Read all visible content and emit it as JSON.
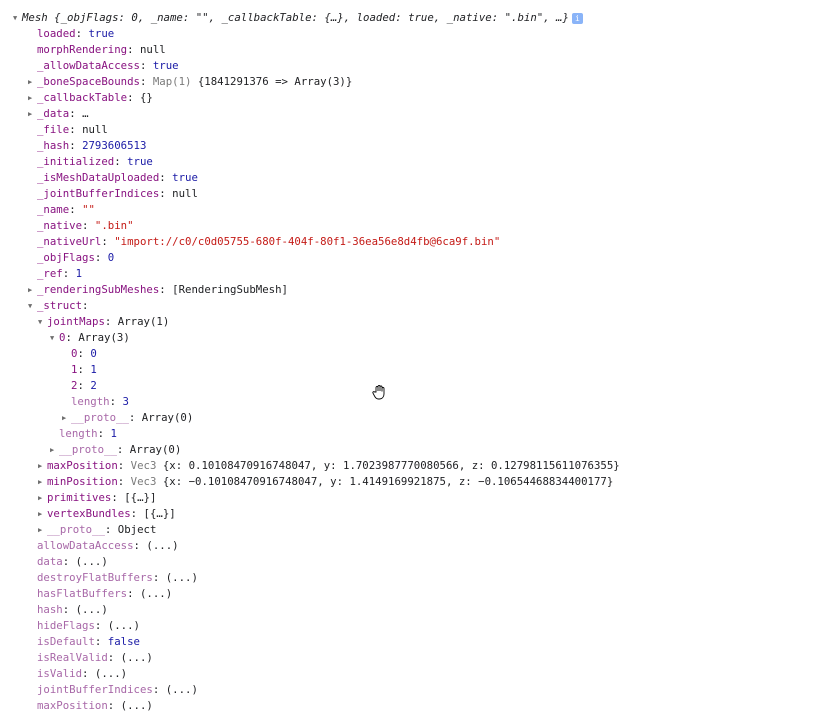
{
  "header": {
    "text": "Mesh {_objFlags: 0, _name: \"\", _callbackTable: {…}, loaded: true, _native: \".bin\", …}",
    "info_icon": "i"
  },
  "rows": [
    {
      "indent": 1,
      "toggle": "none",
      "key": "loaded",
      "kind": "own",
      "sep": ": ",
      "value": "true",
      "vtype": "num"
    },
    {
      "indent": 1,
      "toggle": "none",
      "key": "morphRendering",
      "kind": "own",
      "sep": ": ",
      "value": "null",
      "vtype": "obj"
    },
    {
      "indent": 1,
      "toggle": "none",
      "key": "_allowDataAccess",
      "kind": "own",
      "sep": ": ",
      "value": "true",
      "vtype": "num"
    },
    {
      "indent": 1,
      "toggle": "closed",
      "key": "_boneSpaceBounds",
      "kind": "own",
      "sep": ": ",
      "meta": "Map(1) ",
      "value": "{1841291376 => Array(3)}",
      "vtype": "obj"
    },
    {
      "indent": 1,
      "toggle": "closed",
      "key": "_callbackTable",
      "kind": "own",
      "sep": ": ",
      "value": "{}",
      "vtype": "obj"
    },
    {
      "indent": 1,
      "toggle": "closed",
      "key": "_data",
      "kind": "own",
      "sep": ": ",
      "value": "…",
      "vtype": "obj"
    },
    {
      "indent": 1,
      "toggle": "none",
      "key": "_file",
      "kind": "own",
      "sep": ": ",
      "value": "null",
      "vtype": "obj"
    },
    {
      "indent": 1,
      "toggle": "none",
      "key": "_hash",
      "kind": "own",
      "sep": ": ",
      "value": "2793606513",
      "vtype": "num"
    },
    {
      "indent": 1,
      "toggle": "none",
      "key": "_initialized",
      "kind": "own",
      "sep": ": ",
      "value": "true",
      "vtype": "num"
    },
    {
      "indent": 1,
      "toggle": "none",
      "key": "_isMeshDataUploaded",
      "kind": "own",
      "sep": ": ",
      "value": "true",
      "vtype": "num"
    },
    {
      "indent": 1,
      "toggle": "none",
      "key": "_jointBufferIndices",
      "kind": "own",
      "sep": ": ",
      "value": "null",
      "vtype": "obj"
    },
    {
      "indent": 1,
      "toggle": "none",
      "key": "_name",
      "kind": "own",
      "sep": ": ",
      "value": "\"\"",
      "vtype": "str"
    },
    {
      "indent": 1,
      "toggle": "none",
      "key": "_native",
      "kind": "own",
      "sep": ": ",
      "value": "\".bin\"",
      "vtype": "str"
    },
    {
      "indent": 1,
      "toggle": "none",
      "key": "_nativeUrl",
      "kind": "own",
      "sep": ": ",
      "value": "\"import://c0/c0d05755-680f-404f-80f1-36ea56e8d4fb@6ca9f.bin\"",
      "vtype": "str"
    },
    {
      "indent": 1,
      "toggle": "none",
      "key": "_objFlags",
      "kind": "own",
      "sep": ": ",
      "value": "0",
      "vtype": "num"
    },
    {
      "indent": 1,
      "toggle": "none",
      "key": "_ref",
      "kind": "own",
      "sep": ": ",
      "value": "1",
      "vtype": "num"
    },
    {
      "indent": 1,
      "toggle": "closed",
      "key": "_renderingSubMeshes",
      "kind": "own",
      "sep": ": ",
      "value": "[RenderingSubMesh]",
      "vtype": "obj"
    },
    {
      "indent": 1,
      "toggle": "open",
      "key": "_struct",
      "kind": "own",
      "sep": ":",
      "value": "",
      "vtype": "obj"
    },
    {
      "indent": 2,
      "toggle": "open",
      "key": "jointMaps",
      "kind": "own",
      "sep": ": ",
      "value": "Array(1)",
      "vtype": "obj"
    },
    {
      "indent": 3,
      "toggle": "open",
      "key": "0",
      "kind": "own",
      "sep": ": ",
      "value": "Array(3)",
      "vtype": "obj"
    },
    {
      "indent": 4,
      "toggle": "none",
      "key": "0",
      "kind": "own",
      "sep": ": ",
      "value": "0",
      "vtype": "num"
    },
    {
      "indent": 4,
      "toggle": "none",
      "key": "1",
      "kind": "own",
      "sep": ": ",
      "value": "1",
      "vtype": "num"
    },
    {
      "indent": 4,
      "toggle": "none",
      "key": "2",
      "kind": "own",
      "sep": ": ",
      "value": "2",
      "vtype": "num"
    },
    {
      "indent": 4,
      "toggle": "none",
      "key": "length",
      "kind": "proto",
      "sep": ": ",
      "value": "3",
      "vtype": "num"
    },
    {
      "indent": 4,
      "toggle": "closed",
      "key": "__proto__",
      "kind": "proto",
      "sep": ": ",
      "value": "Array(0)",
      "vtype": "obj"
    },
    {
      "indent": 3,
      "toggle": "none",
      "key": "length",
      "kind": "proto",
      "sep": ": ",
      "value": "1",
      "vtype": "num"
    },
    {
      "indent": 3,
      "toggle": "closed",
      "key": "__proto__",
      "kind": "proto",
      "sep": ": ",
      "value": "Array(0)",
      "vtype": "obj"
    },
    {
      "indent": 2,
      "toggle": "closed",
      "key": "maxPosition",
      "kind": "own",
      "sep": ": ",
      "meta": "Vec3 ",
      "value": "{x: 0.10108470916748047, y: 1.7023987770080566, z: 0.12798115611076355}",
      "vtype": "obj"
    },
    {
      "indent": 2,
      "toggle": "closed",
      "key": "minPosition",
      "kind": "own",
      "sep": ": ",
      "meta": "Vec3 ",
      "value": "{x: −0.10108470916748047, y: 1.4149169921875, z: −0.10654468834400177}",
      "vtype": "obj"
    },
    {
      "indent": 2,
      "toggle": "closed",
      "key": "primitives",
      "kind": "own",
      "sep": ": ",
      "value": "[{…}]",
      "vtype": "obj"
    },
    {
      "indent": 2,
      "toggle": "closed",
      "key": "vertexBundles",
      "kind": "own",
      "sep": ": ",
      "value": "[{…}]",
      "vtype": "obj"
    },
    {
      "indent": 2,
      "toggle": "closed",
      "key": "__proto__",
      "kind": "proto",
      "sep": ": ",
      "value": "Object",
      "vtype": "obj"
    },
    {
      "indent": 1,
      "toggle": "none",
      "key": "allowDataAccess",
      "kind": "proto",
      "sep": ": ",
      "value": "(...)",
      "vtype": "obj"
    },
    {
      "indent": 1,
      "toggle": "none",
      "key": "data",
      "kind": "proto",
      "sep": ": ",
      "value": "(...)",
      "vtype": "obj"
    },
    {
      "indent": 1,
      "toggle": "none",
      "key": "destroyFlatBuffers",
      "kind": "proto",
      "sep": ": ",
      "value": "(...)",
      "vtype": "obj"
    },
    {
      "indent": 1,
      "toggle": "none",
      "key": "hasFlatBuffers",
      "kind": "proto",
      "sep": ": ",
      "value": "(...)",
      "vtype": "obj"
    },
    {
      "indent": 1,
      "toggle": "none",
      "key": "hash",
      "kind": "proto",
      "sep": ": ",
      "value": "(...)",
      "vtype": "obj"
    },
    {
      "indent": 1,
      "toggle": "none",
      "key": "hideFlags",
      "kind": "proto",
      "sep": ": ",
      "value": "(...)",
      "vtype": "obj"
    },
    {
      "indent": 1,
      "toggle": "none",
      "key": "isDefault",
      "kind": "proto",
      "sep": ": ",
      "value": "false",
      "vtype": "num"
    },
    {
      "indent": 1,
      "toggle": "none",
      "key": "isRealValid",
      "kind": "proto",
      "sep": ": ",
      "value": "(...)",
      "vtype": "obj"
    },
    {
      "indent": 1,
      "toggle": "none",
      "key": "isValid",
      "kind": "proto",
      "sep": ": ",
      "value": "(...)",
      "vtype": "obj"
    },
    {
      "indent": 1,
      "toggle": "none",
      "key": "jointBufferIndices",
      "kind": "proto",
      "sep": ": ",
      "value": "(...)",
      "vtype": "obj"
    },
    {
      "indent": 1,
      "toggle": "none",
      "key": "maxPosition",
      "kind": "proto",
      "sep": ": ",
      "value": "(...)",
      "vtype": "obj"
    }
  ]
}
